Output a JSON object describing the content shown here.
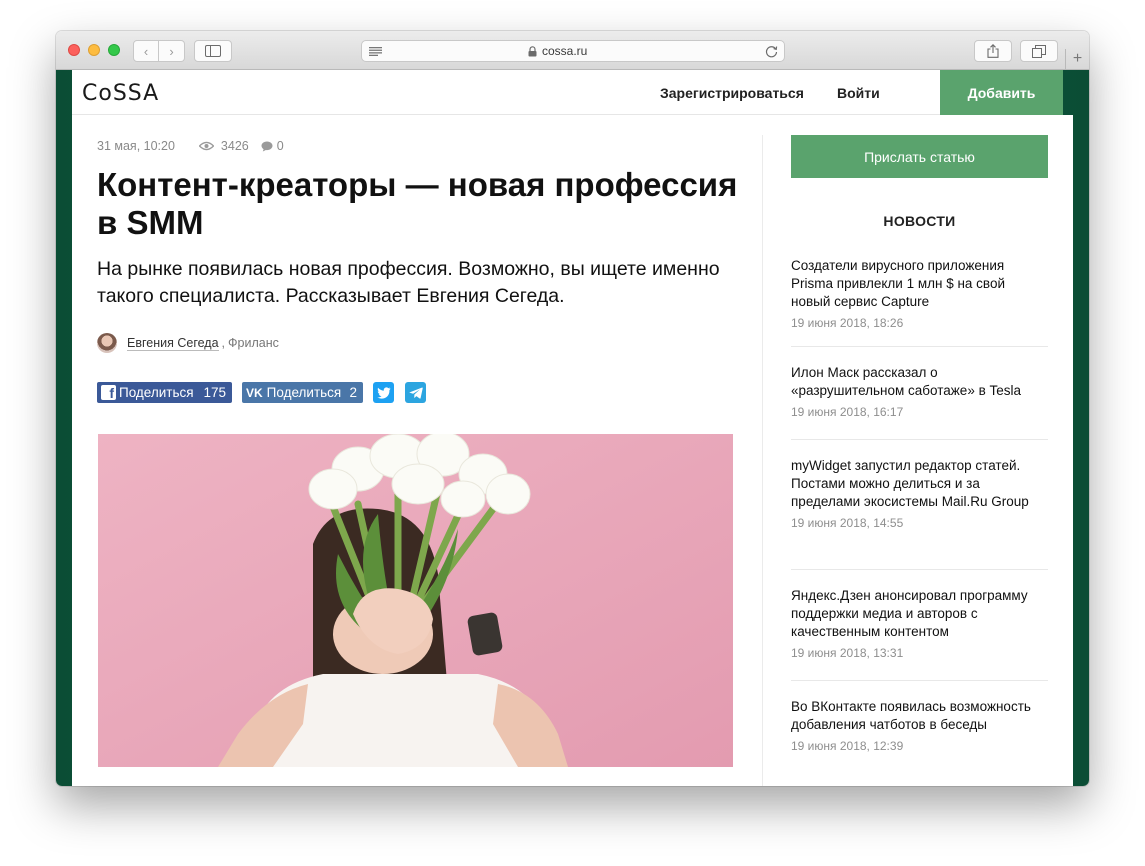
{
  "browser": {
    "url": "cossa.ru",
    "new_tab_glyph": "+",
    "back_glyph": "‹",
    "forward_glyph": "›"
  },
  "site": {
    "logo": "CoSSA",
    "nav": {
      "register": "Зарегистрироваться",
      "login": "Войти",
      "add": "Добавить"
    },
    "accent_color": "#5aa36d",
    "background_color": "#0c5e40"
  },
  "article": {
    "date": "31 мая, 10:20",
    "views": "3426",
    "comments": "0",
    "title": "Контент-креаторы — новая профессия в SMM",
    "subtitle": "На рынке появилась новая профессия. Возможно, вы ищете именно такого специалиста. Рассказывает Евгения Сегеда.",
    "author": "Евгения Сегеда",
    "author_separator": ",",
    "category": "Фриланс",
    "shares": {
      "facebook_label": "Поделиться",
      "facebook_count": "175",
      "vk_label": "Поделиться",
      "vk_count": "2",
      "fb_glyph": "f",
      "vk_glyph": "VK"
    }
  },
  "sidebar": {
    "submit_label": "Прислать статью",
    "news_heading": "НОВОСТИ",
    "news": [
      {
        "title": "Создатели вирусного приложения Prisma привлекли 1 млн $ на свой новый сервис Capture",
        "time": "19 июня 2018, 18:26"
      },
      {
        "title": "Илон Маск рассказал о «разрушительном саботаже» в Tesla",
        "time": "19 июня 2018, 16:17"
      },
      {
        "title": "myWidget запустил редактор статей. Постами можно делиться и за пределами экосистемы Mail.Ru Group",
        "time": "19 июня 2018, 14:55"
      },
      {
        "title": "Яндекс.Дзен анонсировал программу поддержки медиа и авторов с качественным контентом",
        "time": "19 июня 2018, 13:31"
      },
      {
        "title": "Во ВКонтакте появилась возможность добавления чатботов в беседы",
        "time": "19 июня 2018, 12:39"
      }
    ]
  }
}
